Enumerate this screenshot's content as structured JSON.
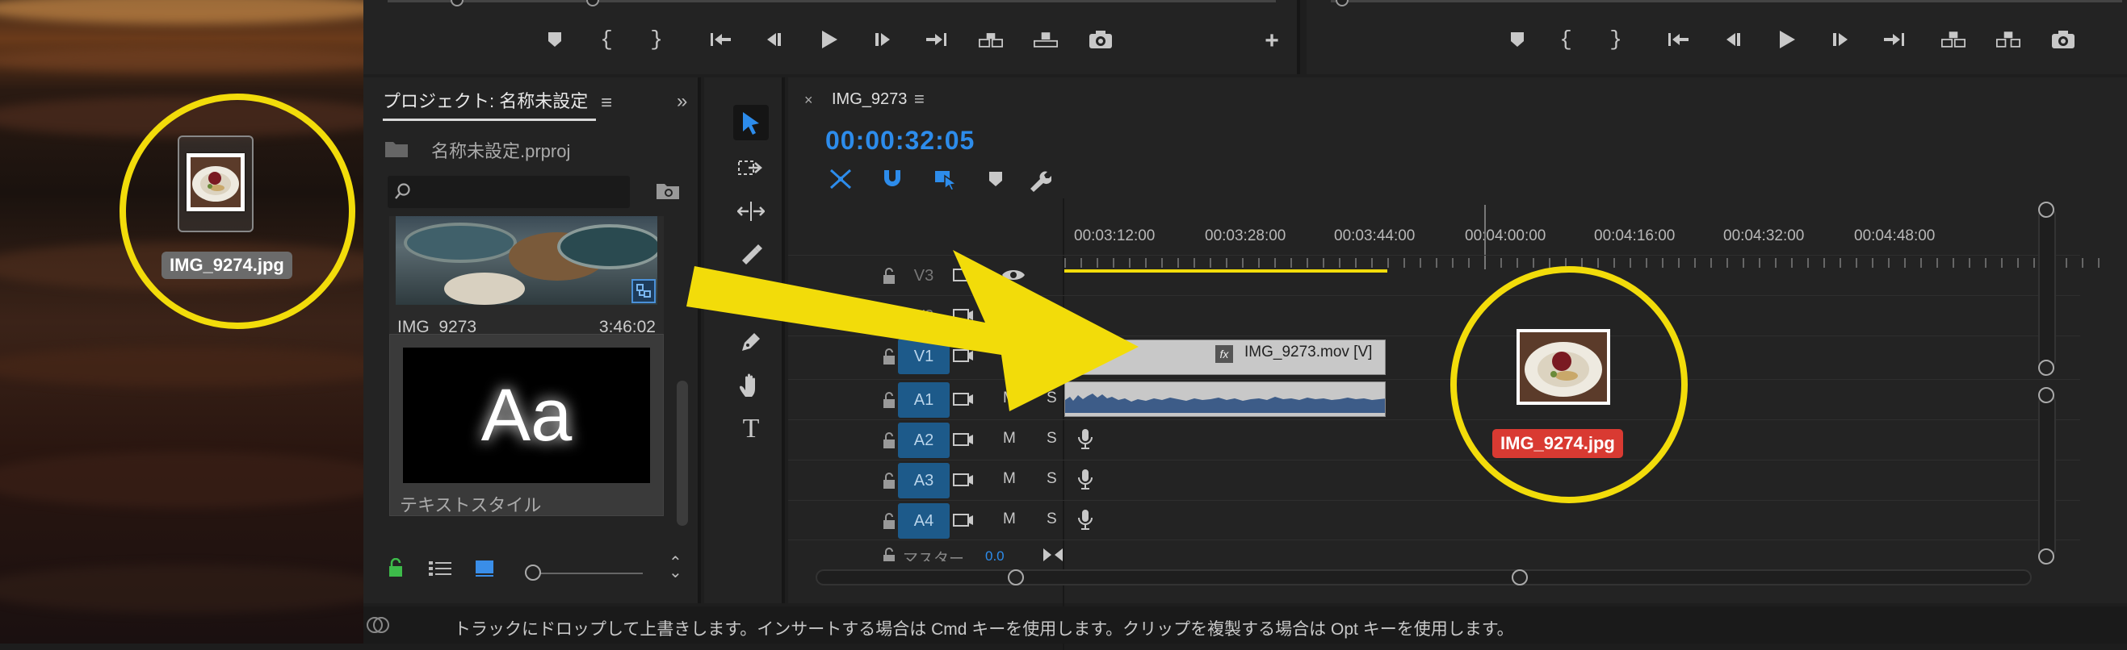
{
  "desktop": {
    "file_label": "IMG_9274.jpg"
  },
  "source_monitor": {
    "controls": [
      "marker-icon",
      "mark-in-icon",
      "mark-out-icon",
      "go-to-in-icon",
      "step-back-icon",
      "play-icon",
      "step-forward-icon",
      "go-to-out-icon",
      "insert-icon",
      "overwrite-icon",
      "camera-icon",
      "add-icon"
    ]
  },
  "project_panel": {
    "title": "プロジェクト: 名称未設定",
    "project_file": "名称未設定.prproj",
    "search_placeholder": "",
    "items": [
      {
        "name": "IMG_9273",
        "duration": "3:46:02"
      },
      {
        "name": "テキストスタイル",
        "thumb_text": "Aa"
      }
    ]
  },
  "timeline": {
    "sequence_name": "IMG_9273",
    "timecode": "00:00:32:05",
    "ruler_labels": [
      "00:03:12:00",
      "00:03:28:00",
      "00:03:44:00",
      "00:04:00:00",
      "00:04:16:00",
      "00:04:32:00",
      "00:04:48:00"
    ],
    "tracks": [
      {
        "id": "V3",
        "type": "video",
        "active": false
      },
      {
        "id": "V2",
        "type": "video",
        "active": false
      },
      {
        "id": "V1",
        "type": "video",
        "active": true
      },
      {
        "id": "A1",
        "type": "audio",
        "active": true
      },
      {
        "id": "A2",
        "type": "audio",
        "active": true
      },
      {
        "id": "A3",
        "type": "audio",
        "active": true
      },
      {
        "id": "A4",
        "type": "audio",
        "active": true
      }
    ],
    "mute_label": "M",
    "solo_label": "S",
    "master_label": "マスター",
    "master_value": "0.0",
    "video_clip_label": "IMG_9273.mov [V]",
    "fx_badge": "fx",
    "drag_label": "IMG_9274.jpg"
  },
  "status_bar": {
    "message": "トラックにドロップして上書きします。インサートする場合は Cmd キーを使用します。クリップを複製する場合は Opt キーを使用します。"
  },
  "colors": {
    "accent_blue": "#2d8ceb",
    "track_active": "#1d5a8a",
    "annotation_yellow": "#f2dc0a",
    "drag_label_red": "#d93a32",
    "audio_waveform": "#3d5c88"
  }
}
